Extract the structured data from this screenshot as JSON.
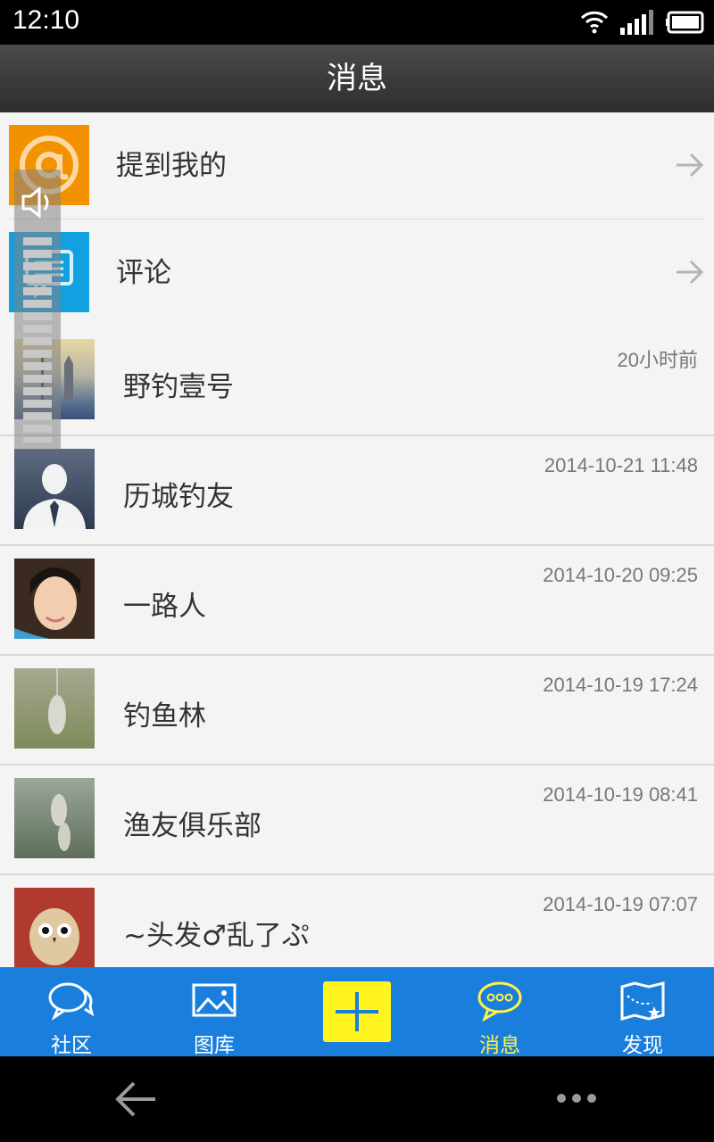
{
  "status_bar": {
    "time": "12:10"
  },
  "header": {
    "title": "消息"
  },
  "nav_rows": [
    {
      "label": "提到我的",
      "icon": "at-icon",
      "color": "#f39200"
    },
    {
      "label": "评论",
      "icon": "comment-icon",
      "color": "#12a0e0"
    }
  ],
  "messages": [
    {
      "name": "野钓壹号",
      "time": "20小时前"
    },
    {
      "name": "历城钓友",
      "time": "2014-10-21 11:48"
    },
    {
      "name": "一路人",
      "time": "2014-10-20 09:25"
    },
    {
      "name": "钓鱼林",
      "time": "2014-10-19 17:24"
    },
    {
      "name": "渔友俱乐部",
      "time": "2014-10-19 08:41"
    },
    {
      "name": "~头发♂乱了ぷ",
      "time": "2014-10-19 07:07"
    }
  ],
  "tabs": [
    {
      "label": "社区",
      "icon": "community-icon"
    },
    {
      "label": "图库",
      "icon": "gallery-icon"
    },
    {
      "label": "",
      "icon": "plus-icon"
    },
    {
      "label": "消息",
      "icon": "message-icon",
      "active": true
    },
    {
      "label": "发现",
      "icon": "discover-icon"
    }
  ],
  "colors": {
    "tabbar": "#1a7fdc",
    "active_tab": "#fff24a",
    "plus_button": "#fff41d"
  }
}
